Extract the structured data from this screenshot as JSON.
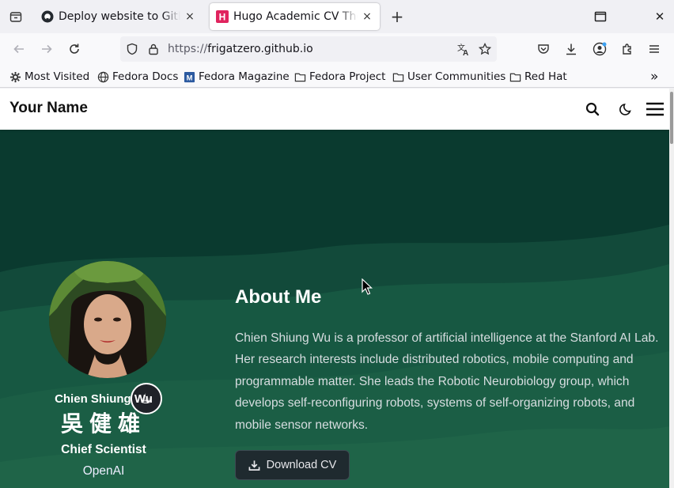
{
  "browser": {
    "tabs": [
      {
        "title": "Deploy website to GitHub",
        "close": "×",
        "active": false
      },
      {
        "title": "Hugo Academic CV Theme",
        "close": "×",
        "active": true
      }
    ],
    "new_tab": "+",
    "window_close": "✕",
    "url_scheme": "https://",
    "url_host": "frigatzero.github.io",
    "bookmarks": [
      {
        "label": "Most Visited",
        "icon": "gear-icon"
      },
      {
        "label": "Fedora Docs",
        "icon": "globe-icon"
      },
      {
        "label": "Fedora Magazine",
        "icon": "fedora-magazine-icon"
      },
      {
        "label": "Fedora Project",
        "icon": "folder-icon"
      },
      {
        "label": "User Communities",
        "icon": "folder-icon"
      },
      {
        "label": "Red Hat",
        "icon": "folder-icon"
      }
    ],
    "overflow": "»"
  },
  "site": {
    "name": "Your Name",
    "profile": {
      "name_en": "Chien Shiung Wu",
      "name_zh": "吳健雄",
      "role": "Chief Scientist",
      "organization": "OpenAI",
      "badge": "☕"
    },
    "about": {
      "title": "About Me",
      "text": "Chien Shiung Wu is a professor of artificial intelligence at the Stanford AI Lab. Her research interests include distributed robotics, mobile computing and programmable matter. She leads the Robotic Neurobiology group, which develops self-reconfiguring robots, systems of self-organizing robots, and mobile sensor networks.",
      "download_label": "Download CV"
    }
  },
  "colors": {
    "hero_bg": "#0b3a30",
    "hero_wave": "#1b5a43",
    "header_bg": "#ffffff"
  }
}
